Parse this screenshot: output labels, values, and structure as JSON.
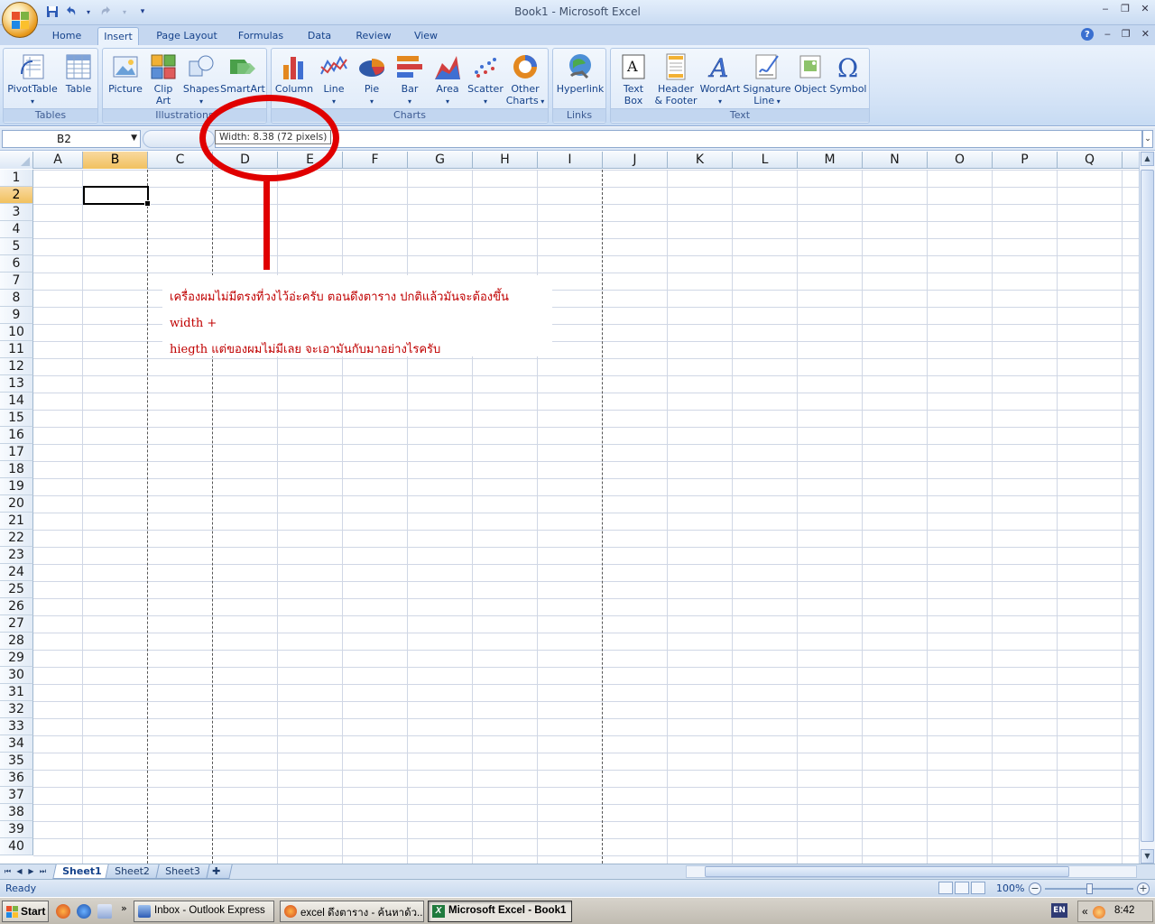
{
  "window": {
    "title": "Book1 - Microsoft Excel"
  },
  "quick_access": {
    "save": "save-icon",
    "undo": "undo-icon",
    "redo": "redo-icon"
  },
  "tabs": [
    {
      "label": "Home"
    },
    {
      "label": "Insert",
      "active": true
    },
    {
      "label": "Page Layout"
    },
    {
      "label": "Formulas"
    },
    {
      "label": "Data"
    },
    {
      "label": "Review"
    },
    {
      "label": "View"
    }
  ],
  "ribbon": {
    "groups": [
      {
        "label": "Tables",
        "buttons": [
          "PivotTable",
          "Table"
        ]
      },
      {
        "label": "Illustrations",
        "buttons": [
          "Picture",
          "Clip Art",
          "Shapes",
          "SmartArt"
        ]
      },
      {
        "label": "Charts",
        "buttons": [
          "Column",
          "Line",
          "Pie",
          "Bar",
          "Area",
          "Scatter",
          "Other Charts"
        ]
      },
      {
        "label": "Links",
        "buttons": [
          "Hyperlink"
        ]
      },
      {
        "label": "Text",
        "buttons": [
          "Text Box",
          "Header & Footer",
          "WordArt",
          "Signature Line",
          "Object",
          "Symbol"
        ]
      }
    ],
    "buttons": {
      "pivottable": "PivotTable",
      "table": "Table",
      "picture": "Picture",
      "clipart_1": "Clip",
      "clipart_2": "Art",
      "shapes": "Shapes",
      "smartart": "SmartArt",
      "column": "Column",
      "line": "Line",
      "pie": "Pie",
      "bar": "Bar",
      "area": "Area",
      "scatter": "Scatter",
      "othercharts_1": "Other",
      "othercharts_2": "Charts",
      "hyperlink": "Hyperlink",
      "textbox_1": "Text",
      "textbox_2": "Box",
      "headerfooter_1": "Header",
      "headerfooter_2": "& Footer",
      "wordart": "WordArt",
      "signature_1": "Signature",
      "signature_2": "Line",
      "object": "Object",
      "symbol": "Symbol"
    },
    "group_labels": {
      "tables": "Tables",
      "illustrations": "Illustrations",
      "charts": "Charts",
      "links": "Links",
      "text": "Text"
    }
  },
  "formula_bar": {
    "name_box": "B2",
    "formula": "",
    "width_tooltip": "Width: 8.38 (72 pixels)"
  },
  "sheet": {
    "columns": [
      "A",
      "B",
      "C",
      "D",
      "E",
      "F",
      "G",
      "H",
      "I",
      "J",
      "K",
      "L",
      "M",
      "N",
      "O",
      "P",
      "Q"
    ],
    "rows": [
      "1",
      "2",
      "3",
      "4",
      "5",
      "6",
      "7",
      "8",
      "9",
      "10",
      "11",
      "12",
      "13",
      "14",
      "15",
      "16",
      "17",
      "18",
      "19",
      "20",
      "21",
      "22",
      "23",
      "24",
      "25",
      "26",
      "27",
      "28",
      "29",
      "30",
      "31",
      "32",
      "33",
      "34",
      "35",
      "36",
      "37",
      "38",
      "39",
      "40"
    ],
    "selected_cell": "B2",
    "selected_column": "B",
    "selected_row": "2"
  },
  "sheet_tabs": [
    {
      "label": "Sheet1",
      "active": true
    },
    {
      "label": "Sheet2"
    },
    {
      "label": "Sheet3"
    }
  ],
  "status_bar": {
    "status": "Ready",
    "zoom": "100%"
  },
  "taskbar": {
    "start": "Start",
    "tasks": [
      {
        "label": "Inbox - Outlook Express"
      },
      {
        "label": "excel ดึงตาราง - ค้นหาด้ว..."
      },
      {
        "label": "Microsoft Excel - Book1",
        "active": true
      }
    ],
    "language": "EN",
    "clock": "8:42"
  },
  "annotation": {
    "line1": "เครื่องผมไม่มีตรงที่วงไว้อ่ะครับ ตอนดึงตาราง ปกติแล้วมันจะต้องขึ้น width +",
    "line2": "hiegth แต่ของผมไม่มีเลย จะเอามันกับมาอย่างไรครับ",
    "color": "#e00000"
  }
}
